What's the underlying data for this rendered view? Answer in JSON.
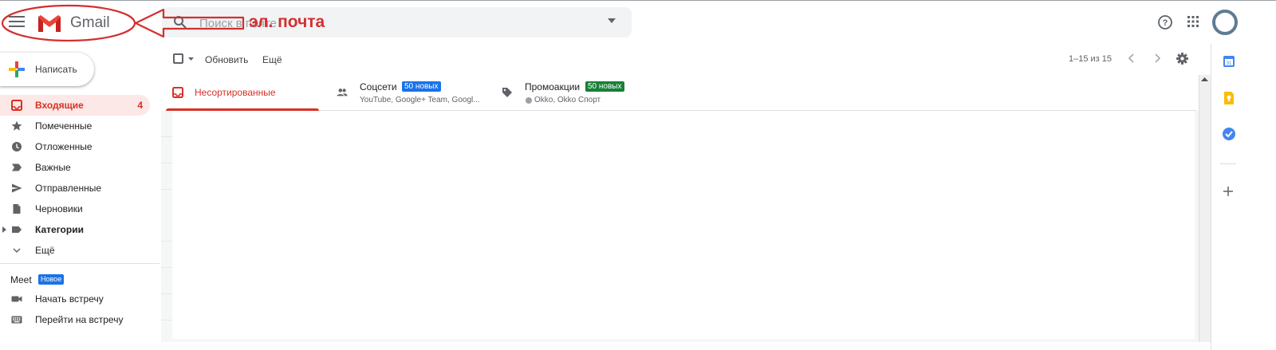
{
  "header": {
    "app_name": "Gmail",
    "search_placeholder": "Поиск в почте",
    "annotation_text": "эл. почта"
  },
  "compose": {
    "label": "Написать"
  },
  "sidebar": {
    "items": [
      {
        "label": "Входящие",
        "count": "4",
        "icon": "inbox-icon",
        "active": true
      },
      {
        "label": "Помеченные",
        "icon": "star-icon"
      },
      {
        "label": "Отложенные",
        "icon": "clock-icon"
      },
      {
        "label": "Важные",
        "icon": "important-icon"
      },
      {
        "label": "Отправленные",
        "icon": "send-icon"
      },
      {
        "label": "Черновики",
        "icon": "draft-icon"
      },
      {
        "label": "Категории",
        "icon": "label-icon"
      },
      {
        "label": "Ещё",
        "icon": "chevron-down-icon"
      }
    ],
    "meet": {
      "title": "Meet",
      "badge": "Новое",
      "items": [
        {
          "label": "Начать встречу",
          "icon": "video-icon"
        },
        {
          "label": "Перейти на встречу",
          "icon": "keyboard-icon"
        }
      ]
    }
  },
  "toolbar": {
    "refresh_label": "Обновить",
    "more_label": "Ещё",
    "pagination": "1–15 из 15"
  },
  "tabs": [
    {
      "label": "Несортированные",
      "icon": "inbox-icon",
      "active": true
    },
    {
      "label": "Соцсети",
      "badge": "50 новых",
      "badge_color": "#1a73e8",
      "sub": "YouTube, Google+ Team, Googl...",
      "icon": "people-icon"
    },
    {
      "label": "Промоакции",
      "badge": "50 новых",
      "badge_color": "#188038",
      "sub": "Okko, Okko Спорт",
      "icon": "tag-icon"
    }
  ],
  "colors": {
    "accent_red": "#d93025",
    "social_blue": "#1a73e8",
    "promo_green": "#188038",
    "annotation_red": "#d32f2f"
  }
}
